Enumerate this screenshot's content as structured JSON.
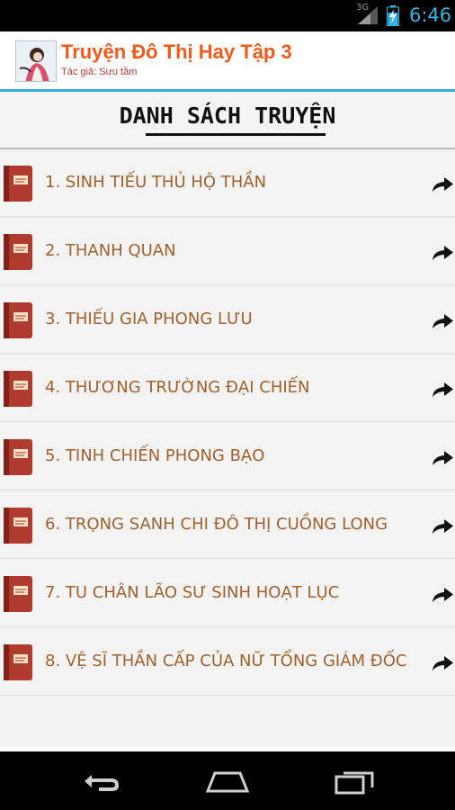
{
  "status_bar": {
    "network_label": "3G",
    "time": "6:46"
  },
  "header": {
    "title": "Truyện Đô Thị Hay Tập 3",
    "subtitle": "Tác giả: Sưu tầm",
    "logo_icon": "book-cover-avatar-icon"
  },
  "section": {
    "heading": "DANH SÁCH TRUYỆN"
  },
  "stories": [
    {
      "label": "1. SINH TIẾU THỦ HỘ THẦN"
    },
    {
      "label": "2. THANH QUAN"
    },
    {
      "label": "3. THIẾU GIA PHONG LƯU"
    },
    {
      "label": "4. THƯƠNG TRƯỜNG ĐẠI CHIẾN"
    },
    {
      "label": "5. TINH CHIẾN PHONG BẠO"
    },
    {
      "label": "6. TRỌNG SANH CHI ĐÔ THỊ CUỒNG LONG"
    },
    {
      "label": "7. TU CHÂN LÃO SƯ SINH HOẠT LỤC"
    },
    {
      "label": "8. VỆ SĨ THẦN CẤP CỦA NỮ TỔNG GIÁM ĐỐC"
    }
  ],
  "colors": {
    "title": "#f05a1a",
    "accent_rule": "#34aee0",
    "item_text": "#a0612c",
    "book_icon": "#b03a2e"
  },
  "nav": {
    "back_icon": "back-icon",
    "home_icon": "home-icon",
    "recents_icon": "recents-icon"
  }
}
